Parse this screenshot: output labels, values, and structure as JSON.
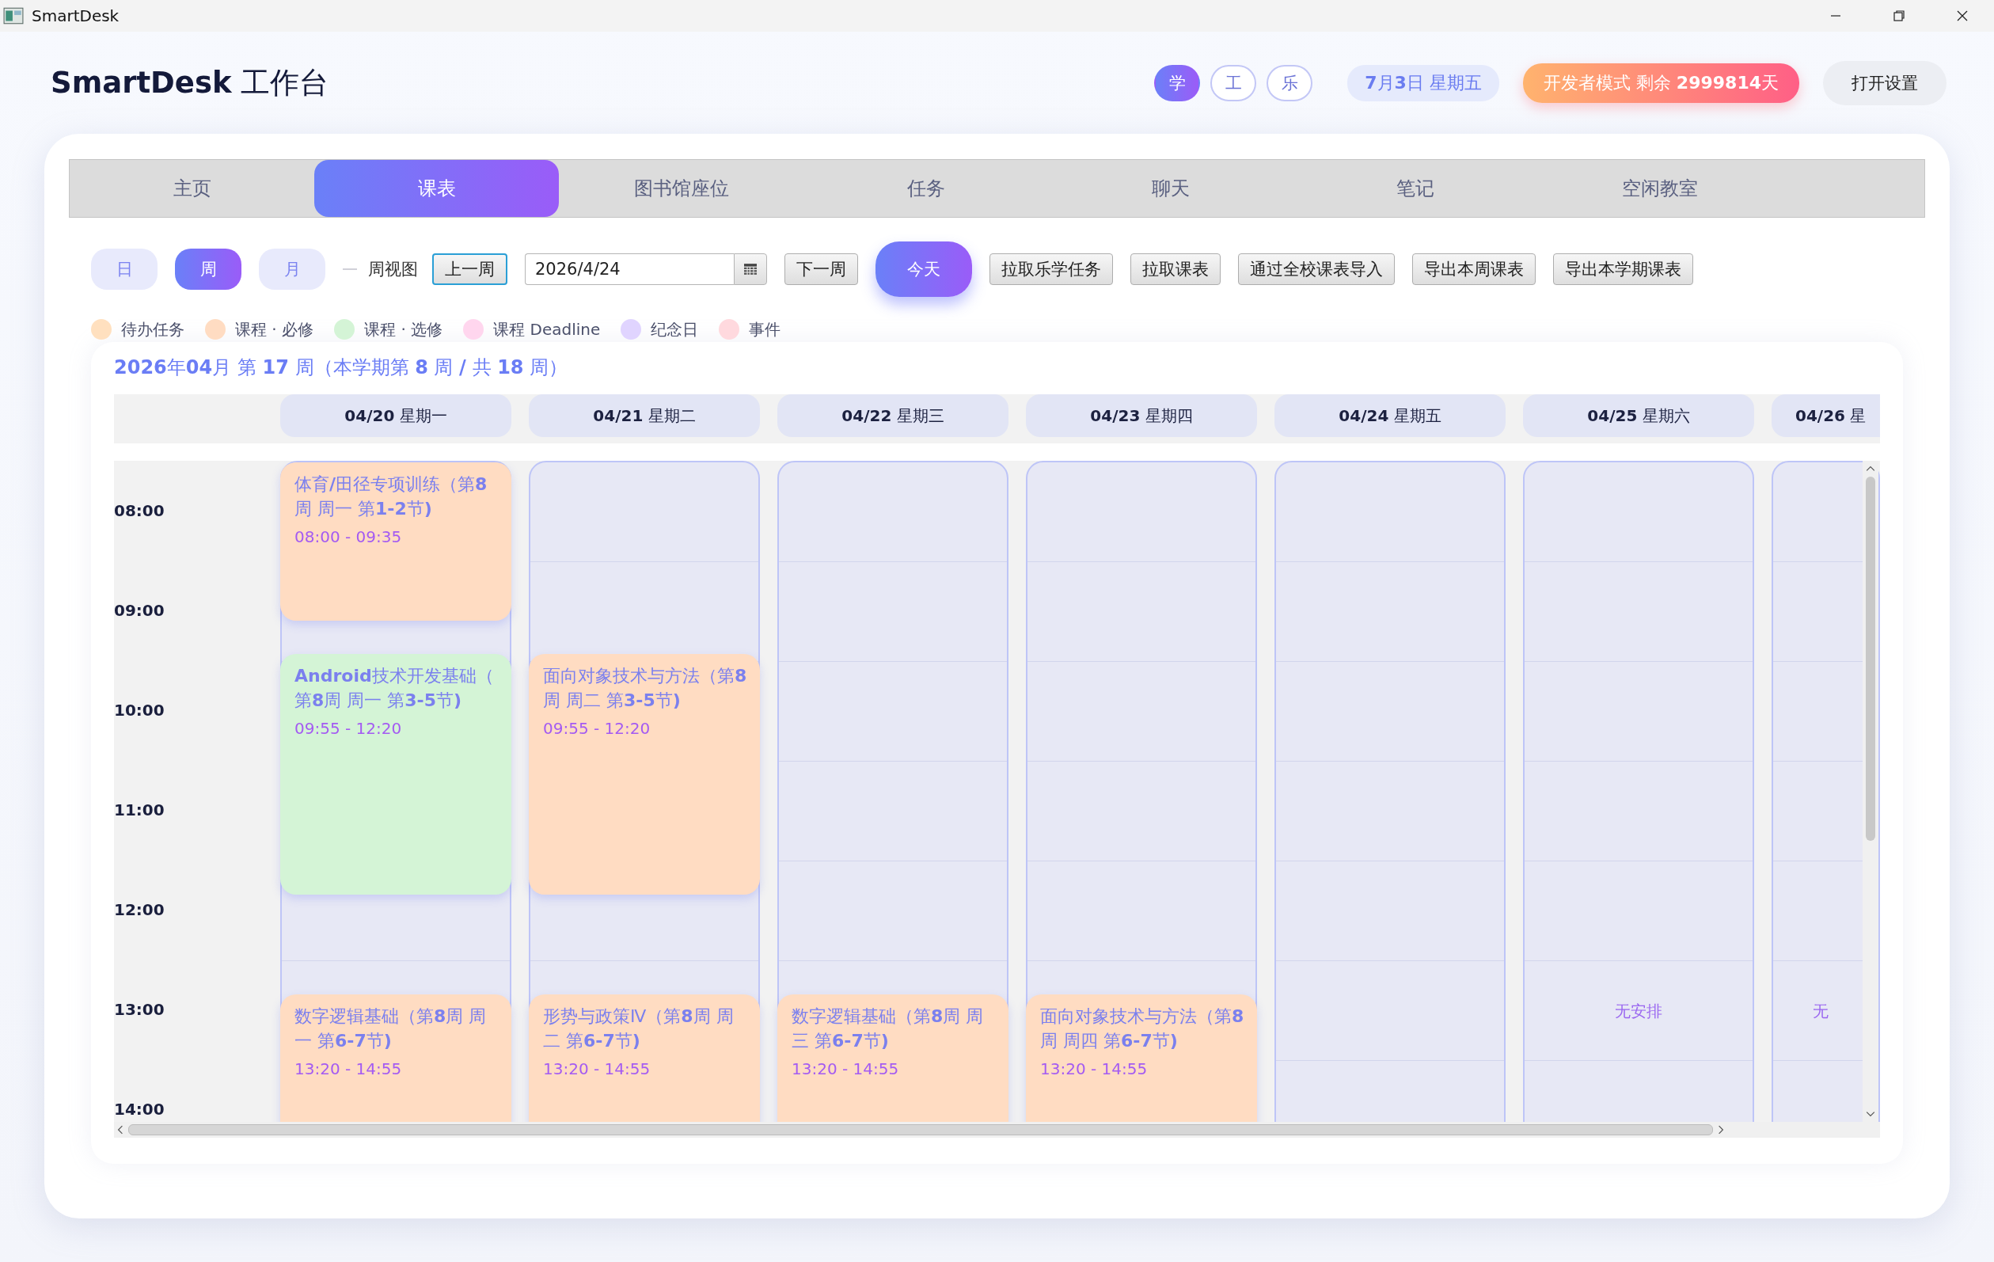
{
  "window": {
    "title": "SmartDesk"
  },
  "header": {
    "logo": "**SmartDesk** 工作台",
    "modes": [
      {
        "label": "学",
        "selected": true
      },
      {
        "label": "工",
        "selected": false
      },
      {
        "label": "乐",
        "selected": false
      }
    ],
    "date": "**7**月**3**日 星期五",
    "dev_badge": "开发者模式 剩余 **2999814**天",
    "settings_button": "打开设置"
  },
  "tabs": [
    {
      "label": "主页",
      "selected": false
    },
    {
      "label": "课表",
      "selected": true
    },
    {
      "label": "图书馆座位",
      "selected": false
    },
    {
      "label": "任务",
      "selected": false
    },
    {
      "label": "聊天",
      "selected": false
    },
    {
      "label": "笔记",
      "selected": false
    },
    {
      "label": "空闲教室",
      "selected": false
    }
  ],
  "toolbar": {
    "views": [
      {
        "label": "日",
        "selected": false
      },
      {
        "label": "周",
        "selected": true
      },
      {
        "label": "月",
        "selected": false
      }
    ],
    "view_label": "周视图",
    "prev_button": {
      "label": "上一周",
      "focused": true
    },
    "date_field": {
      "value": "2026/4/24"
    },
    "next_button": "下一周",
    "today_button": "今天",
    "actions": [
      "拉取乐学任务",
      "拉取课表",
      "通过全校课表导入",
      "导出本周课表",
      "导出本学期课表"
    ]
  },
  "legend": [
    {
      "label": "待办任务",
      "color": "#ffe0bf"
    },
    {
      "label": "课程 · 必修",
      "color": "#ffdcc2"
    },
    {
      "label": "课程 · 选修",
      "color": "#d4f4d6"
    },
    {
      "label": "课程 Deadline",
      "color": "#ffd6ee"
    },
    {
      "label": "纪念日",
      "color": "#e0d4ff"
    },
    {
      "label": "事件",
      "color": "#ffd9de"
    }
  ],
  "calendar": {
    "title": "**2026**年**04**月 第 **17** 周（本学期第 **8** 周 **/** 共 **18** 周）",
    "hours": [
      "08:00",
      "09:00",
      "10:00",
      "11:00",
      "12:00",
      "13:00",
      "14:00"
    ],
    "days": [
      {
        "label": "**04/20** 星期一",
        "events": [
          {
            "title": "体育**/**田径专项训练（第**8**周 周一 第**1-2**节**)**",
            "time": "08:00 - 09:35",
            "color": "#ffdcc2"
          },
          {
            "title": "**Android**技术开发基础（第**8**周 周一 第**3-5**节**)**",
            "time": "09:55 - 12:20",
            "color": "#d4f4d6"
          },
          {
            "title": "数字逻辑基础（第**8**周 周一 第**6-7**节**)**",
            "time": "13:20 - 14:55",
            "color": "#ffdcc2"
          }
        ]
      },
      {
        "label": "**04/21** 星期二",
        "events": [
          {
            "title": "面向对象技术与方法（第**8**周 周二 第**3-5**节**)**",
            "time": "09:55 - 12:20",
            "color": "#ffdcc2"
          },
          {
            "title": "形势与政策Ⅳ（第**8**周 周二 第**6-7**节**)**",
            "time": "13:20 - 14:55",
            "color": "#ffdcc2"
          }
        ]
      },
      {
        "label": "**04/22** 星期三",
        "events": [
          {
            "title": "数字逻辑基础（第**8**周 周三 第**6-7**节**)**",
            "time": "13:20 - 14:55",
            "color": "#ffdcc2"
          }
        ]
      },
      {
        "label": "**04/23** 星期四",
        "events": [
          {
            "title": "面向对象技术与方法（第**8**周 周四 第**6-7**节**)**",
            "time": "13:20 - 14:55",
            "color": "#ffdcc2"
          }
        ]
      },
      {
        "label": "**04/24** 星期五"
      },
      {
        "label": "**04/25** 星期六",
        "note": "无安排"
      },
      {
        "label": "**04/26** 星",
        "note": "无"
      }
    ]
  }
}
